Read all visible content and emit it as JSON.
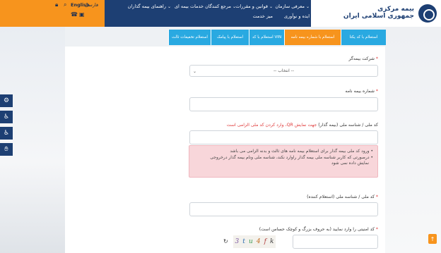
{
  "header": {
    "logo_line1": "بیمه مرکزی",
    "logo_line2": "جمهوری اسلامی ایران",
    "nav": [
      "معرفی سازمان",
      "قوانین و مقررات",
      "مرجع کنندگان خدمات بیمه ای",
      "راهنمای بیمه گذاران",
      "ایده و نوآوری",
      "میز خدمت"
    ],
    "lang_fa": "فارسی",
    "lang_en": "English"
  },
  "tabs": [
    "استعلام با کد یکتا",
    "استعلام با شماره بیمه نامه",
    "استعلام با کد VIN",
    "استعلام با پیامک",
    "استعلام تخفیفات ثالث"
  ],
  "active_tab_index": 1,
  "form": {
    "company_label": "شرکت بیمه‌گر",
    "company_select": "-- انتخاب --",
    "policy_label": "شماره بیمه نامه",
    "national_id_label": "کد ملی / شناسه ملی (بیمه گذار)",
    "national_id_hint": "جهت نمایش QR، وارد کردن کد ملی الزامی است",
    "alert_lines": [
      "ورود کد ملی بیمه گذار برای استعلام بیمه نامه های ثالث و بدنه الزامی می باشد",
      "درصورتی که کاربر شناسه ملی بیمه گذار راوارد نکند، شناسه ملی ونام بیمه گذار درخروجی",
      "نمایش داده نمی شود"
    ],
    "inquirer_label": "کد ملی / شناسه ملی (استعلام کننده)",
    "captcha_label": "کد امنیتی را وارد نمایید (به حروف بزرگ و کوچک حساس است)",
    "captcha_chars": [
      "3",
      "t",
      "u",
      "4",
      "f",
      "k"
    ],
    "required_mark": "*"
  },
  "colors": {
    "header_blue": "#1d3f73",
    "accent_orange": "#f7941d",
    "tab_blue": "#29a9e1",
    "alert_bg": "#f8d6da",
    "required_red": "#e03a3a"
  },
  "icons": [
    "search-icon",
    "lock-icon",
    "phone-icon",
    "cart-icon",
    "settings-icon",
    "accessibility-icon",
    "wheelchair-icon",
    "sign-language-icon",
    "refresh-icon",
    "arrow-up-icon"
  ]
}
